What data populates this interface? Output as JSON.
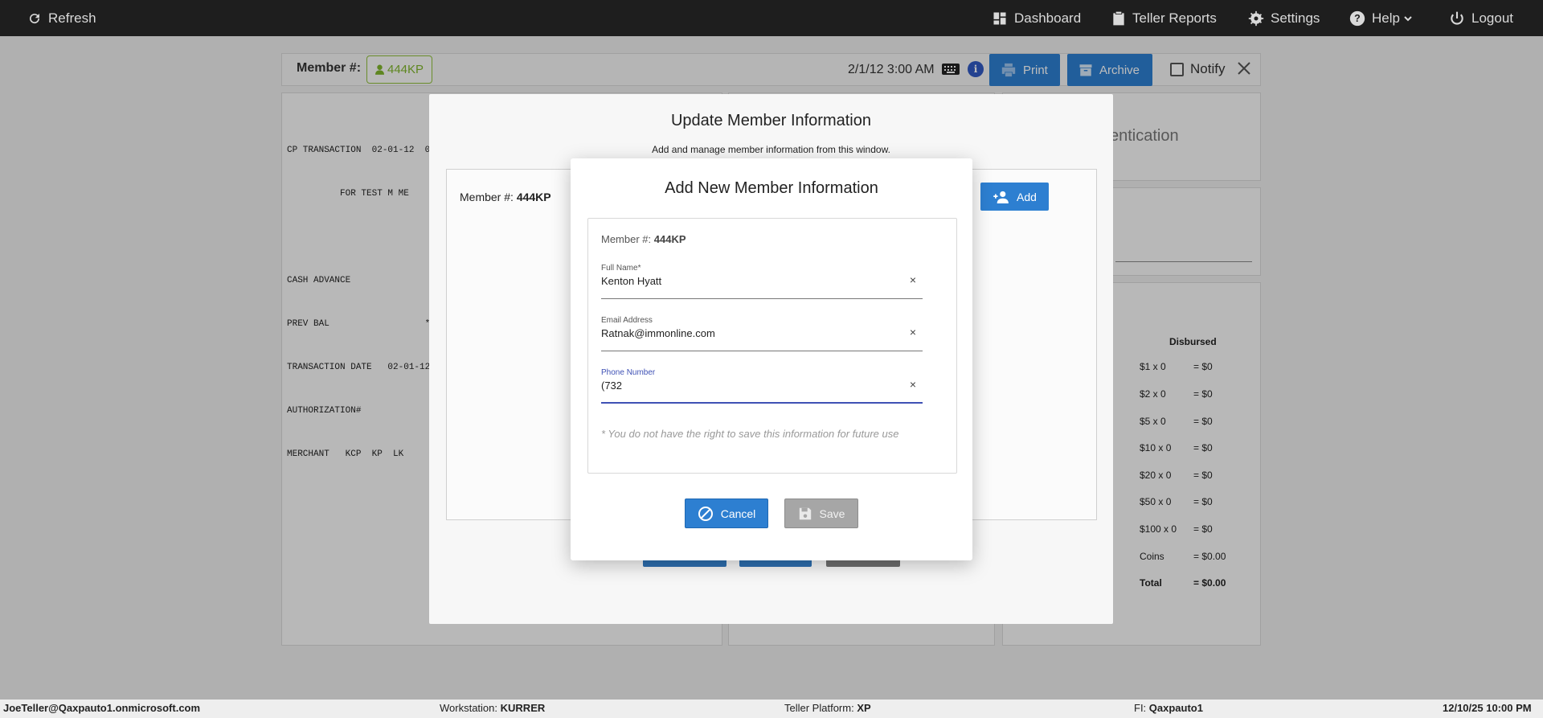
{
  "topbar": {
    "refresh": "Refresh",
    "dashboard": "Dashboard",
    "teller_reports": "Teller Reports",
    "settings": "Settings",
    "help": "Help",
    "logout": "Logout"
  },
  "member_bar": {
    "label": "Member #:",
    "member_id": "444KP",
    "datetime": "2/1/12 3:00 AM",
    "print": "Print",
    "archive": "Archive",
    "notify": "Notify"
  },
  "receipt_lines": [
    "CP TRANSACTION  02-01-12  0",
    "          FOR TEST M ME",
    "",
    "CASH ADVANCE",
    "PREV BAL                  *",
    "TRANSACTION DATE   02-01-12",
    "AUTHORIZATION#",
    "MERCHANT   KCP  KP  LK"
  ],
  "authentication_partial": "entication",
  "disbursed": {
    "header": "Disbursed",
    "rows": [
      {
        "denom": "$1 x 0",
        "amount": "= $0"
      },
      {
        "denom": "$2 x 0",
        "amount": "= $0"
      },
      {
        "denom": "$5 x 0",
        "amount": "= $0"
      },
      {
        "denom": "$10 x 0",
        "amount": "= $0"
      },
      {
        "denom": "$20 x 0",
        "amount": "= $0"
      },
      {
        "denom": "$50 x 0",
        "amount": "= $0"
      },
      {
        "denom": "$100 x 0",
        "amount": "= $0"
      },
      {
        "denom": "Coins",
        "amount": "= $0.00"
      },
      {
        "denom": "Total",
        "amount": "= $0.00"
      }
    ]
  },
  "update_modal": {
    "title": "Update Member Information",
    "subtitle": "Add and manage member information from this window.",
    "member_label": "Member #:",
    "member_id": "444KP",
    "add": "Add"
  },
  "add_dialog": {
    "title": "Add New Member Information",
    "member_label": "Member #:",
    "member_id": "444KP",
    "full_name": {
      "label": "Full Name*",
      "value": "Kenton Hyatt"
    },
    "email": {
      "label": "Email Address",
      "value": "Ratnak@immonline.com"
    },
    "phone": {
      "label": "Phone Number",
      "value": "(732"
    },
    "clear_glyph": "×",
    "note": "* You do not have the right to save this information for future use",
    "cancel": "Cancel",
    "save": "Save"
  },
  "statusbar": {
    "user": "JoeTeller@Qaxpauto1.onmicrosoft.com",
    "workstation_label": "Workstation:",
    "workstation": "KURRER",
    "platform_label": "Teller Platform:",
    "platform": "XP",
    "fi_label": "FI:",
    "fi": "Qaxpauto1",
    "datetime": "12/10/25 10:00 PM"
  },
  "colors": {
    "accent": "#2d7fd1",
    "focus": "#3f51b5",
    "member_chip": "#7fb52c",
    "topbar": "#1e1e1e"
  }
}
